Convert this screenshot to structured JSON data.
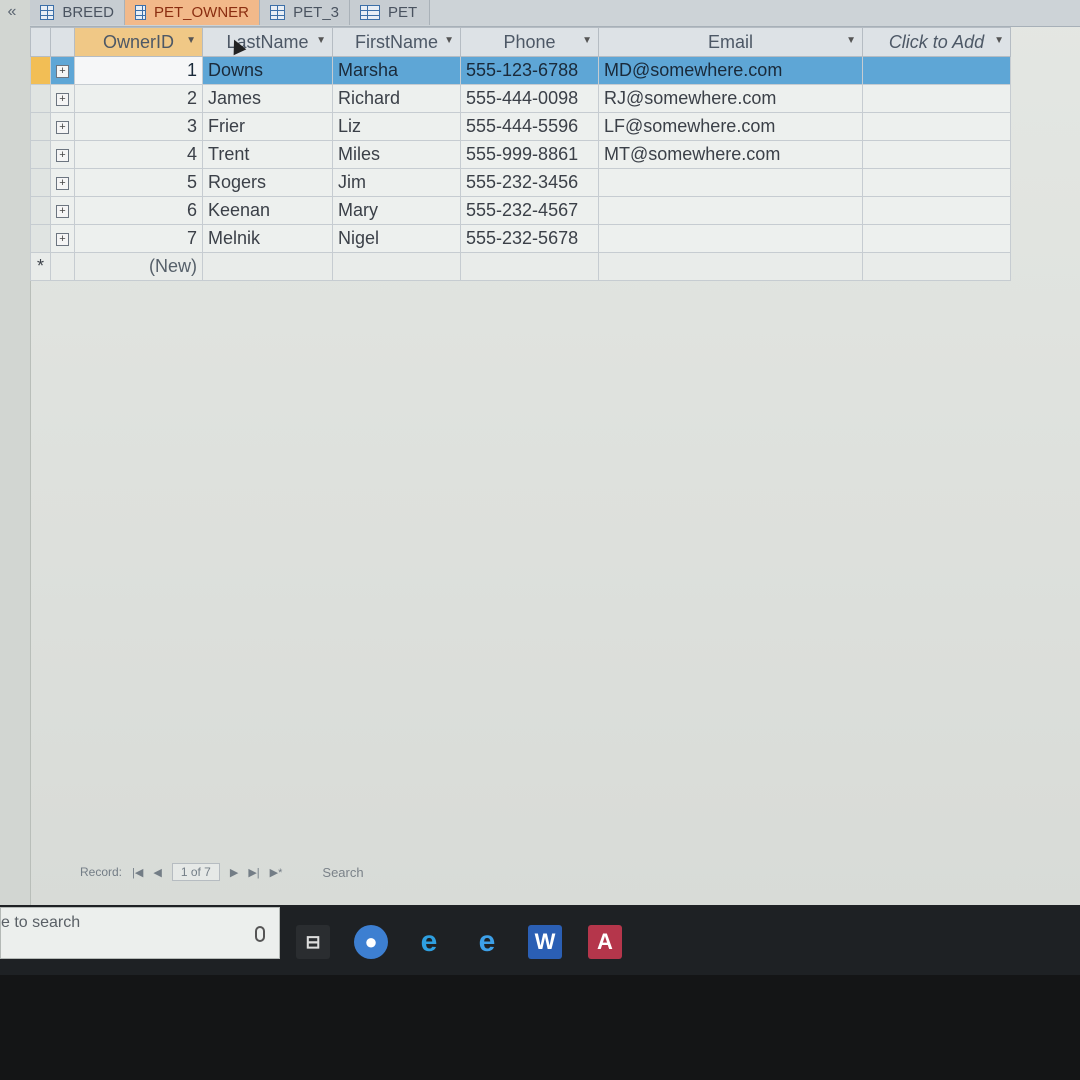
{
  "tabs": [
    {
      "label": "BREED",
      "active": false
    },
    {
      "label": "PET_OWNER",
      "active": true
    },
    {
      "label": "PET_3",
      "active": false
    },
    {
      "label": "PET",
      "active": false
    }
  ],
  "collapse_label": "«",
  "columns": [
    "OwnerID",
    "LastName",
    "FirstName",
    "Phone",
    "Email",
    "Click to Add"
  ],
  "rows": [
    {
      "id": "1",
      "last": "Downs",
      "first": "Marsha",
      "phone": "555-123-6788",
      "email": "MD@somewhere.com"
    },
    {
      "id": "2",
      "last": "James",
      "first": "Richard",
      "phone": "555-444-0098",
      "email": "RJ@somewhere.com"
    },
    {
      "id": "3",
      "last": "Frier",
      "first": "Liz",
      "phone": "555-444-5596",
      "email": "LF@somewhere.com"
    },
    {
      "id": "4",
      "last": "Trent",
      "first": "Miles",
      "phone": "555-999-8861",
      "email": "MT@somewhere.com"
    },
    {
      "id": "5",
      "last": "Rogers",
      "first": "Jim",
      "phone": "555-232-3456",
      "email": ""
    },
    {
      "id": "6",
      "last": "Keenan",
      "first": "Mary",
      "phone": "555-232-4567",
      "email": ""
    },
    {
      "id": "7",
      "last": "Melnik",
      "first": "Nigel",
      "phone": "555-232-5678",
      "email": ""
    }
  ],
  "new_row_label": "(New)",
  "navigation": {
    "record_label": "Record:",
    "position": "1 of 7",
    "search_label": "Search"
  },
  "taskbar": {
    "search_text": "e to search"
  },
  "colors": {
    "active_tab": "#f2b98a",
    "selected_row": "#5ea6d6",
    "header_highlight": "#f0c886"
  }
}
